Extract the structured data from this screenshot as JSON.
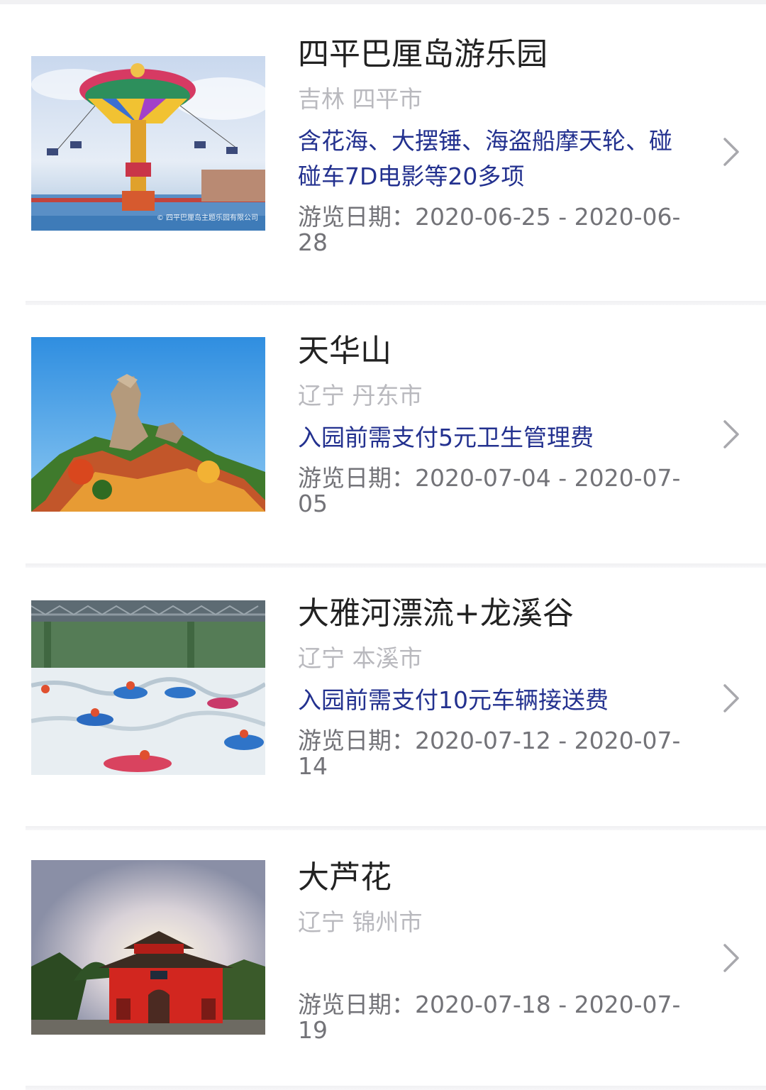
{
  "items": [
    {
      "title": "四平巴厘岛游乐园",
      "region": "吉林 四平市",
      "note": "含花海、大摆锤、海盗船摩天轮、碰碰车7D电影等20多项",
      "dates": "游览日期：2020-06-25 - 2020-06-28",
      "photo": "swing-ride-photo",
      "photo_watermark": "© 四平巴厘岛主题乐园有限公司"
    },
    {
      "title": "天华山",
      "region": "辽宁 丹东市",
      "note": "入园前需支付5元卫生管理费",
      "dates": "游览日期：2020-07-04 - 2020-07-05",
      "photo": "mountain-rock-photo"
    },
    {
      "title": "大雅河漂流+龙溪谷",
      "region": "辽宁 本溪市",
      "note": "入园前需支付10元车辆接送费",
      "dates": "游览日期：2020-07-12 - 2020-07-14",
      "photo": "rafting-photo"
    },
    {
      "title": "大芦花",
      "region": "辽宁 锦州市",
      "note": "",
      "dates": "游览日期：2020-07-18 - 2020-07-19",
      "photo": "red-gate-temple-photo"
    }
  ],
  "icons": {
    "chevron": "chevron-right-icon"
  },
  "colors": {
    "note": "#23318f",
    "title": "#222222",
    "region": "#b9b9be",
    "dates": "#737378"
  }
}
